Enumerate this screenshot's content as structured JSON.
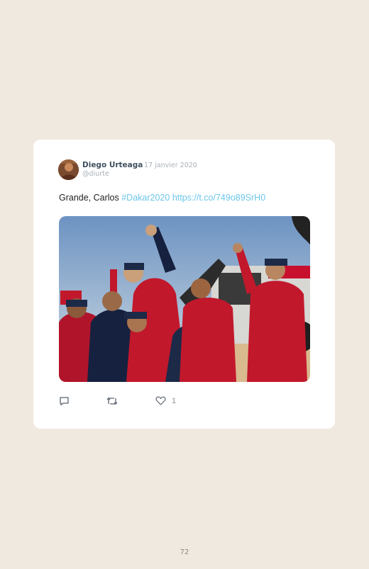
{
  "tweet": {
    "author_name": "Diego Urteaga",
    "date": "· 17 janvier 2020",
    "handle": "@diurte",
    "text_plain": "Grande, Carlos ",
    "hashtag": "#Dakar2020",
    "link": "https://t.co/749o89SrH0",
    "like_count": "1"
  },
  "page": {
    "number": "72"
  },
  "icons": {
    "reply": "reply-icon",
    "retweet": "retweet-icon",
    "like": "heart-icon"
  },
  "colors": {
    "background": "#efe9df",
    "card": "#ffffff",
    "link": "#6cc6ea",
    "author": "#3f4f5f",
    "muted": "#a9b1b8"
  }
}
